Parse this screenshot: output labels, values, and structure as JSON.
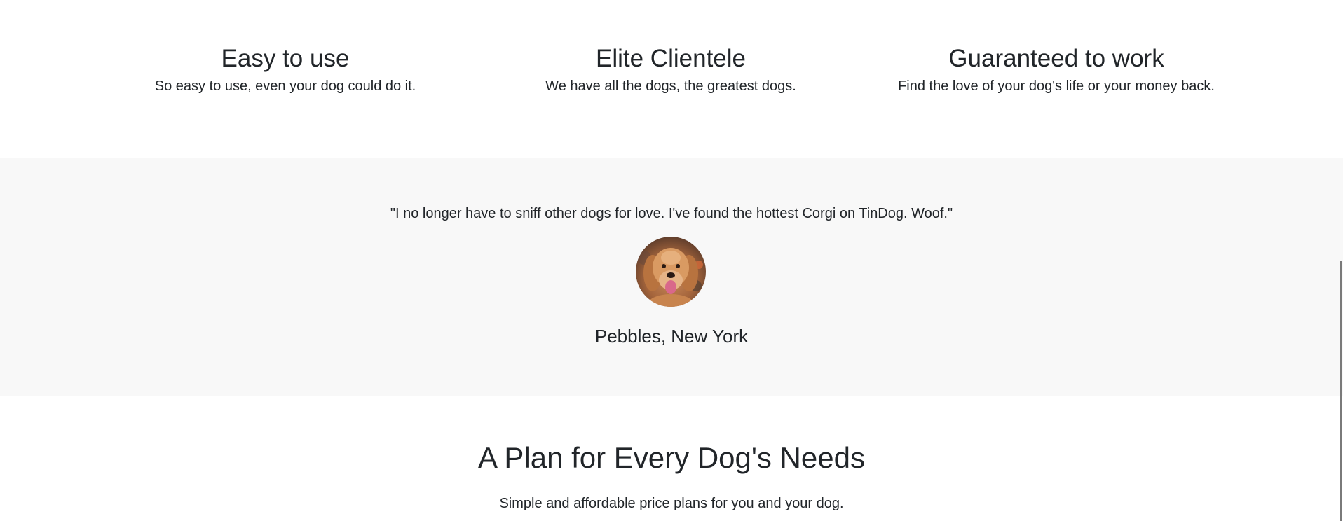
{
  "features": [
    {
      "title": "Easy to use",
      "description": "So easy to use, even your dog could do it."
    },
    {
      "title": "Elite Clientele",
      "description": "We have all the dogs, the greatest dogs."
    },
    {
      "title": "Guaranteed to work",
      "description": "Find the love of your dog's life or your money back."
    }
  ],
  "testimonial": {
    "quote": "\"I no longer have to sniff other dogs for love. I've found the hottest Corgi on TinDog. Woof.\"",
    "avatar_icon": "dog-photo",
    "author": "Pebbles, New York"
  },
  "pricing": {
    "title": "A Plan for Every Dog's Needs",
    "subtitle": "Simple and affordable price plans for you and your dog."
  },
  "colors": {
    "text": "#212529",
    "testimonial_bg": "#f8f8f8",
    "page_bg": "#ffffff"
  }
}
